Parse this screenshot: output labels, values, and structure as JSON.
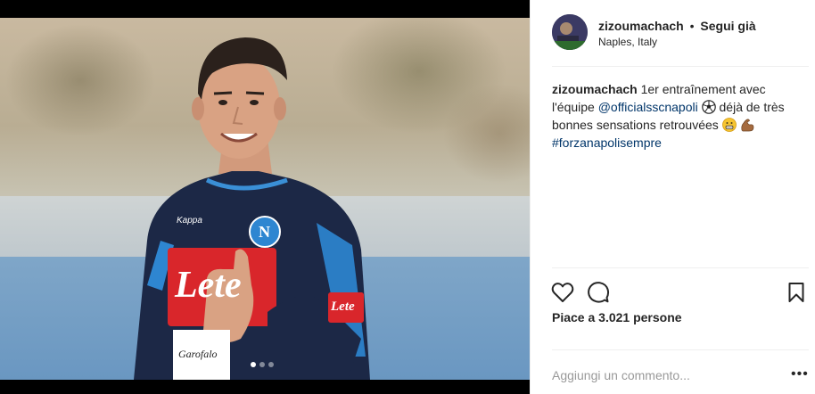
{
  "header": {
    "username": "zizoumachach",
    "separator": "•",
    "follow_status": "Segui già",
    "location": "Naples, Italy"
  },
  "caption": {
    "username": "zizoumachach",
    "text_1": "1er entraînement avec l'équipe",
    "mention": "@officialsscnapoli",
    "text_2": "déjà de très bonnes sensations retrouvées",
    "hashtag": "#forzanapolisempre",
    "emojis": [
      "soccer-ball-emoji",
      "grinning-face-emoji",
      "flexed-biceps-emoji"
    ]
  },
  "photo": {
    "shirt_sponsor": "Lete",
    "sleeve_sponsor": "Lete",
    "kit_brand": "Kappa",
    "badge_letter": "N",
    "sleeve_logo": "Garofalo"
  },
  "carousel": {
    "count": 3,
    "active_index": 0
  },
  "actions": {
    "icons": [
      "heart-icon",
      "comment-icon",
      "bookmark-icon"
    ],
    "likes_prefix": "Piace a",
    "likes_count": "3.021",
    "likes_suffix": "persone"
  },
  "comment": {
    "placeholder": "Aggiungi un commento...",
    "more_label": "•••"
  },
  "colors": {
    "text": "#262626",
    "link": "#003569",
    "divider": "#efefef",
    "jersey": "#1c2846",
    "sponsor_red": "#d9262b"
  }
}
